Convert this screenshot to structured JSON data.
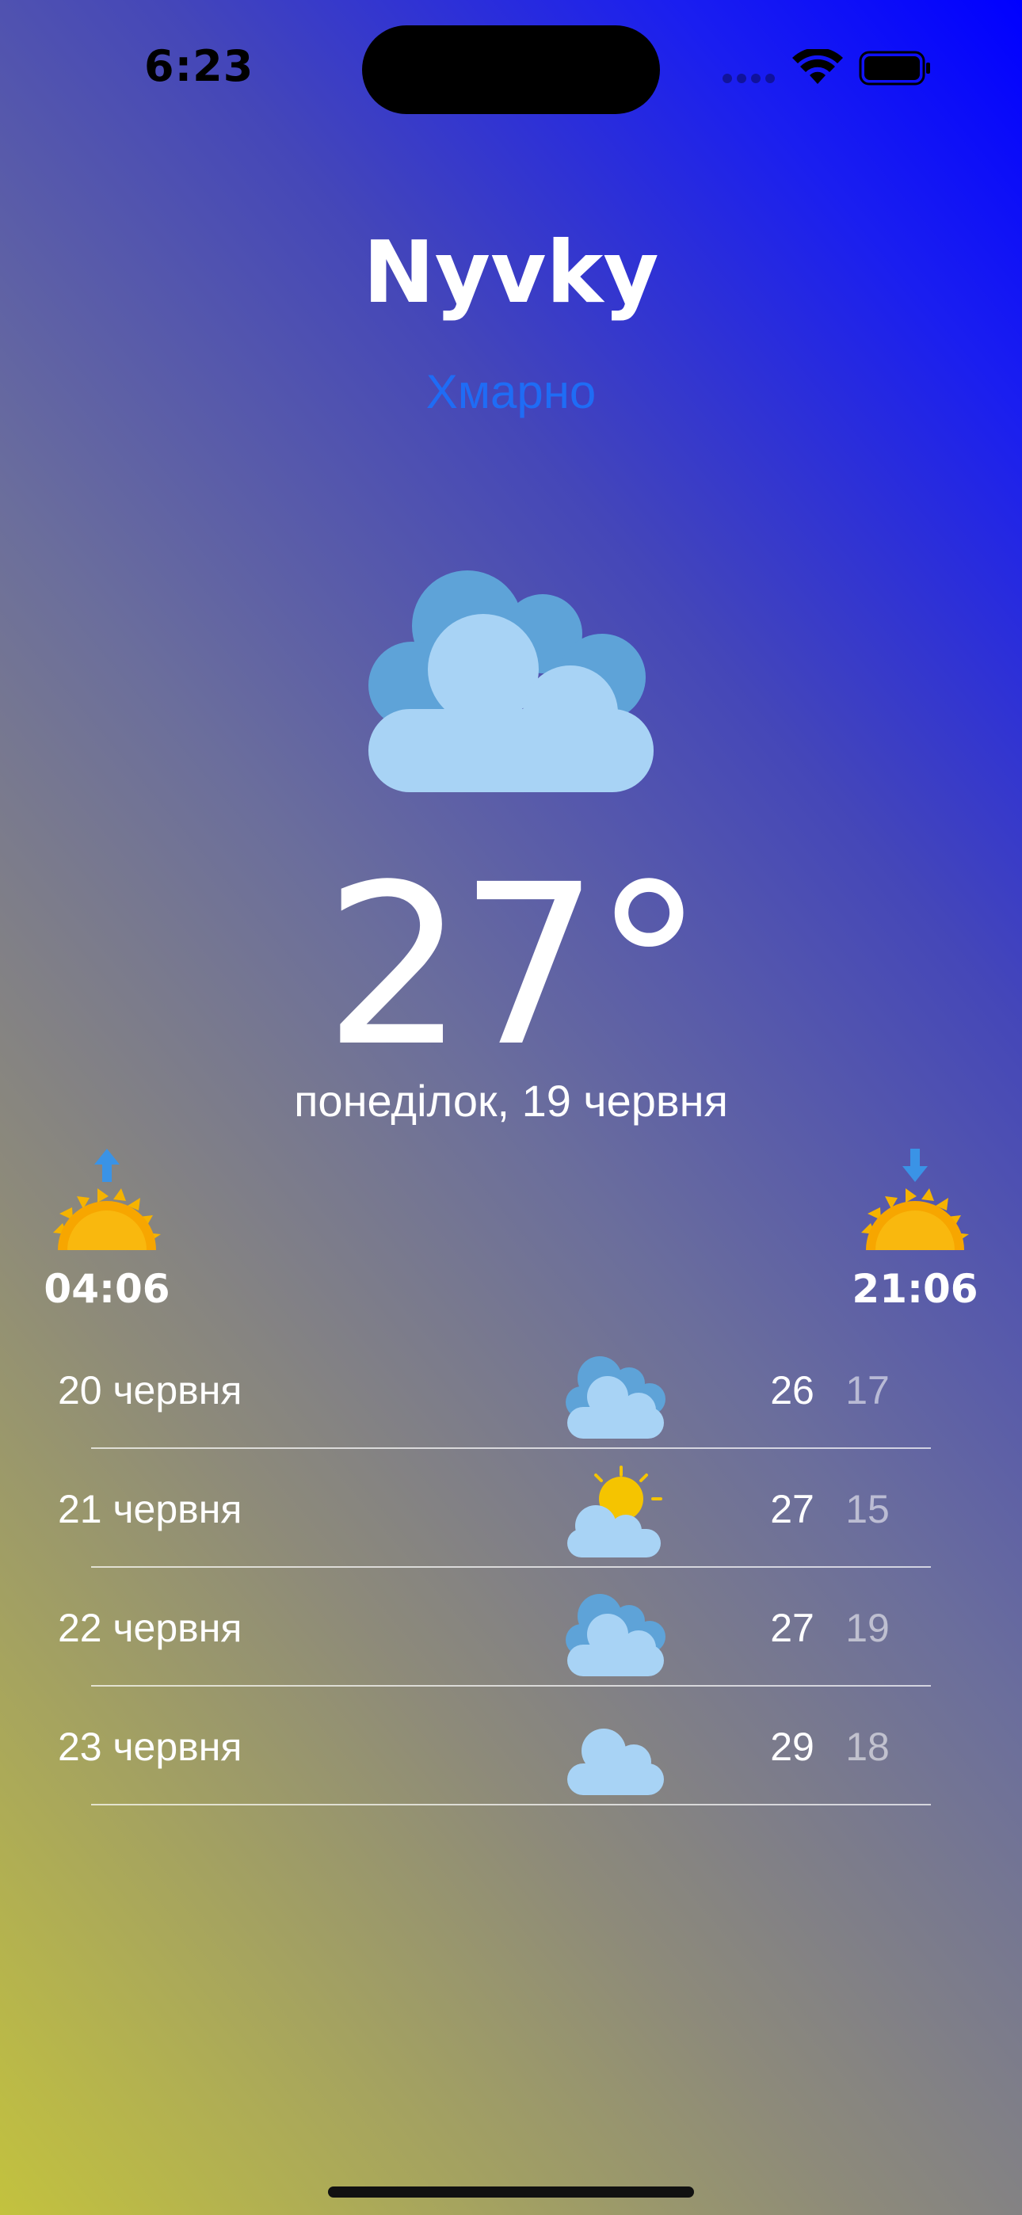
{
  "status_bar": {
    "time": "6:23"
  },
  "location": {
    "city": "Nyvky",
    "condition": "Хмарно"
  },
  "current": {
    "temperature": "27°",
    "date": "понеділок, 19 червня",
    "icon": "cloudy-icon"
  },
  "sun": {
    "sunrise": "04:06",
    "sunset": "21:06",
    "sunrise_icon": "sunrise-icon",
    "sunset_icon": "sunset-icon"
  },
  "forecast": [
    {
      "day": "20 червня",
      "icon": "cloudy-icon",
      "high": "26",
      "low": "17"
    },
    {
      "day": "21 червня",
      "icon": "partly-sunny-icon",
      "high": "27",
      "low": "15"
    },
    {
      "day": "22 червня",
      "icon": "cloudy-icon",
      "high": "27",
      "low": "19"
    },
    {
      "day": "23 червня",
      "icon": "cloud-icon",
      "high": "29",
      "low": "18"
    }
  ],
  "colors": {
    "accent": "#1f6cf5",
    "gradient_top_right": "#0000ff",
    "gradient_bottom_left": "#c3c23e"
  }
}
